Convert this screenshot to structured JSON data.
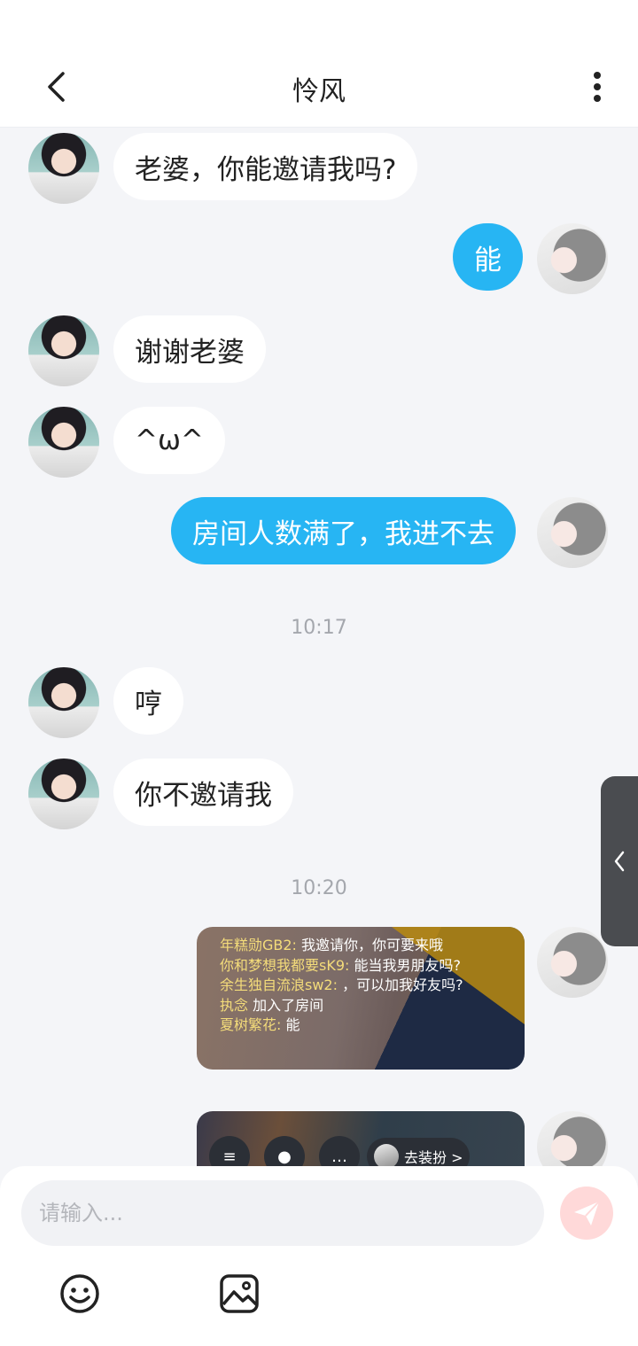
{
  "header": {
    "title": "怜风"
  },
  "messages": [
    {
      "side": "other",
      "text": "老婆，你能邀请我吗?"
    },
    {
      "side": "self",
      "text": "能"
    },
    {
      "side": "other",
      "text": "谢谢老婆"
    },
    {
      "side": "other",
      "text": "^ω^"
    },
    {
      "side": "self",
      "text": "房间人数满了，我进不去"
    },
    {
      "side": "time",
      "text": "10:17"
    },
    {
      "side": "other",
      "text": "哼"
    },
    {
      "side": "other",
      "text": "你不邀请我"
    },
    {
      "side": "time",
      "text": "10:20"
    }
  ],
  "shared_image_1": {
    "lines": [
      {
        "name": "年糕勋GB2:",
        "text": "我邀请你，你可要来哦"
      },
      {
        "name": "你和梦想我都要sK9:",
        "text": "能当我男朋友吗?"
      },
      {
        "name": "余生独自流浪sw2:",
        "text": "，可以加我好友吗?"
      },
      {
        "name": "执念",
        "text": "加入了房间"
      },
      {
        "name": "夏树繁花:",
        "text": "能"
      }
    ]
  },
  "shared_image_2": {
    "dress_label": "去装扮 >"
  },
  "composer": {
    "placeholder": "请输入..."
  },
  "icons": {
    "back": "chevron-left-icon",
    "more": "more-vertical-icon",
    "side_tab": "chevron-left-icon",
    "send": "send-icon",
    "emoji": "emoji-icon",
    "image": "image-icon"
  },
  "colors": {
    "self_bubble": "#27b5f3",
    "other_bubble": "#ffffff",
    "background": "#f4f5f8",
    "send_button": "#ffd9d9"
  }
}
